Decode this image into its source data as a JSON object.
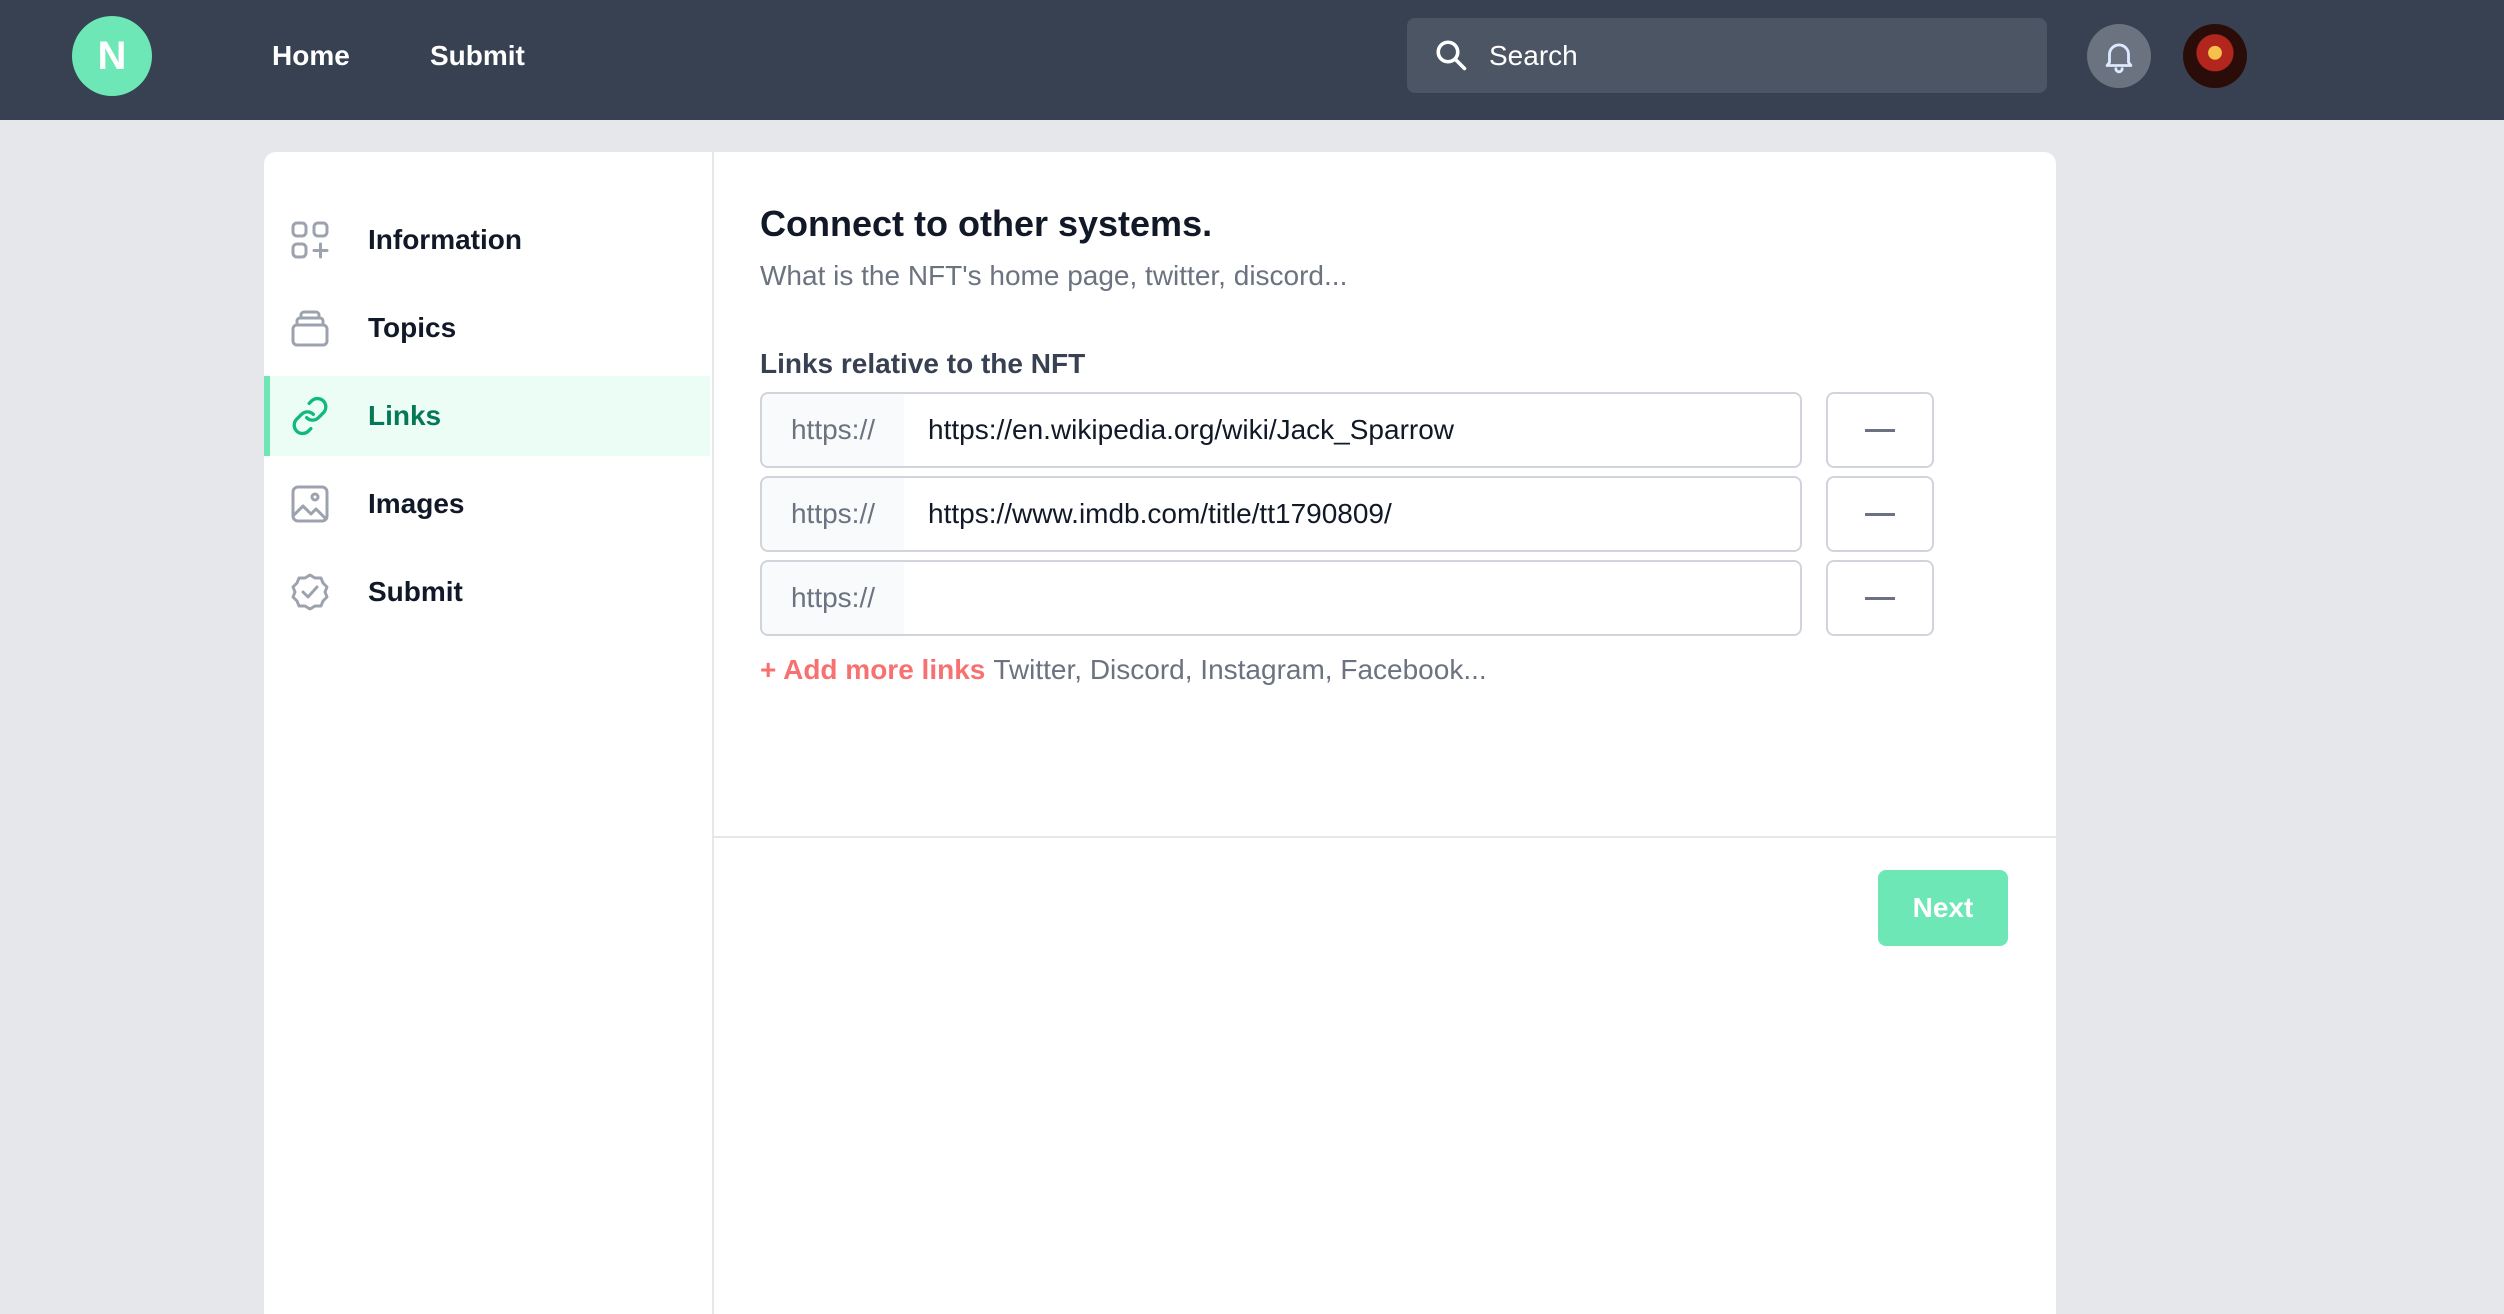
{
  "header": {
    "logo_letter": "N",
    "nav": [
      {
        "label": "Home"
      },
      {
        "label": "Submit"
      }
    ],
    "search_placeholder": "Search"
  },
  "sidebar": {
    "items": [
      {
        "label": "Information",
        "icon": "apps-icon",
        "active": false
      },
      {
        "label": "Topics",
        "icon": "stack-icon",
        "active": false
      },
      {
        "label": "Links",
        "icon": "link-icon",
        "active": true
      },
      {
        "label": "Images",
        "icon": "image-icon",
        "active": false
      },
      {
        "label": "Submit",
        "icon": "check-badge-icon",
        "active": false
      }
    ]
  },
  "main": {
    "title": "Connect to other systems.",
    "subtitle": "What is the NFT's home page, twitter, discord...",
    "links_label": "Links relative to the NFT",
    "links": [
      {
        "prefix": "https://",
        "value": "https://en.wikipedia.org/wiki/Jack_Sparrow"
      },
      {
        "prefix": "https://",
        "value": "https://www.imdb.com/title/tt1790809/"
      },
      {
        "prefix": "https://",
        "value": ""
      }
    ],
    "add_more_label": "+ Add more links",
    "add_more_hint": "Twitter, Discord, Instagram, Facebook...",
    "next_label": "Next"
  },
  "colors": {
    "topbar": "#374151",
    "accent": "#6ee7b7",
    "active_text": "#047857",
    "add_link": "#f87171"
  }
}
